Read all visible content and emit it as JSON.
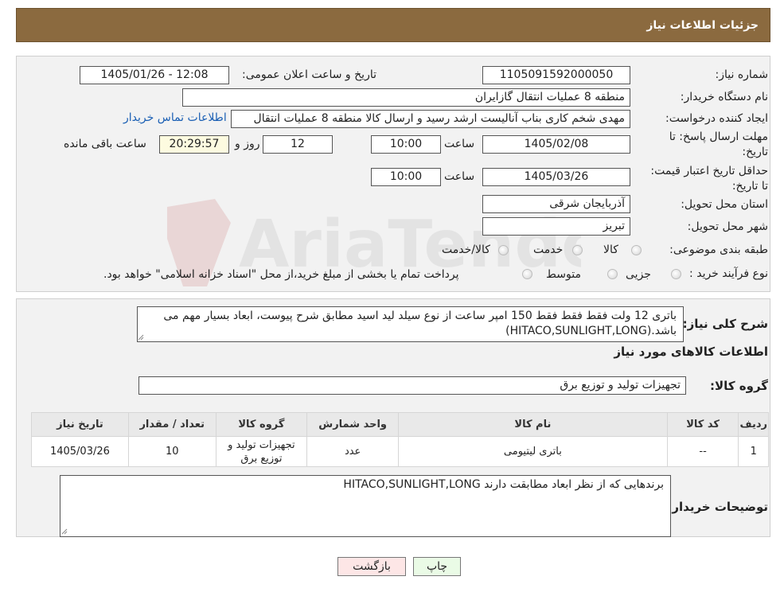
{
  "header": {
    "title": "جزئيات اطلاعات نیاز"
  },
  "watermark": {
    "text": "AriaTender.neT"
  },
  "form": {
    "need_number": {
      "label": "شماره نیاز:",
      "value": "1105091592000050"
    },
    "announce_datetime": {
      "label": "تاریخ و ساعت اعلان عمومی:",
      "value": "1405/01/26 - 12:08"
    },
    "buyer_org": {
      "label": "نام دستگاه خريدار:",
      "value": "منطقه 8 عملیات انتقال گازایران"
    },
    "requester": {
      "label": "ایجاد کننده درخواست:",
      "value": "مهدی شخم کاری بناب آنالیست ارشد رسید و ارسال کالا منطقه 8 عملیات انتقال",
      "contact_link": "اطلاعات تماس خریدار"
    },
    "reply_deadline": {
      "label": "مهلت ارسال پاسخ: تا تاریخ:",
      "date": "1405/02/08",
      "time_label": "ساعت",
      "time": "10:00",
      "days": "12",
      "days_label": "روز و",
      "remaining": "20:29:57",
      "remaining_label": "ساعت باقی مانده"
    },
    "price_validity": {
      "label": "حداقل تاریخ اعتبار قیمت: تا تاریخ:",
      "date": "1405/03/26",
      "time_label": "ساعت",
      "time": "10:00"
    },
    "province": {
      "label": "استان محل تحویل:",
      "value": "آذربایجان شرقی"
    },
    "city": {
      "label": "شهر محل تحویل:",
      "value": "تبریز"
    },
    "category": {
      "label": "طبقه بندی موضوعی:",
      "options": [
        "کالا",
        "خدمت",
        "کالا/خدمت"
      ]
    },
    "purchase_type": {
      "label": "نوع فرآیند خرید :",
      "options": [
        "جزیی",
        "متوسط"
      ],
      "note": "پرداخت تمام یا بخشی از مبلغ خرید،از محل \"اسناد خزانه اسلامی\" خواهد بود."
    }
  },
  "description": {
    "label": "شرح کلی نیاز:",
    "text": "باتری 12 ولت فقط فقط فقط 150 امپر ساعت از نوع سیلد لید اسید مطابق شرح پیوست، ابعاد بسیار مهم می باشد.(HITACO,SUNLIGHT,LONG)"
  },
  "goods": {
    "section_title": "اطلاعات کالاهای مورد نیاز",
    "group_label": "گروه کالا:",
    "group_value": "تجهیزات تولید و توزیع برق",
    "columns": [
      "ردیف",
      "کد کالا",
      "نام کالا",
      "واحد شمارش",
      "گروه کالا",
      "تعداد / مقدار",
      "تاریخ نیاز"
    ],
    "rows": [
      [
        "1",
        "--",
        "باتری لیتیومی",
        "عدد",
        "تجهیزات تولید و توزیع برق",
        "10",
        "1405/03/26"
      ]
    ]
  },
  "buyer_notes": {
    "label": "توضیحات خریدار:",
    "text": "برندهایی که از نظر ابعاد مطابقت دارند HITACO,SUNLIGHT,LONG"
  },
  "buttons": {
    "print": "چاپ",
    "back": "بازگشت"
  },
  "colors": {
    "header_bg": "#8b6a3f",
    "link": "#1a5fb4",
    "print_bg": "#eafbe6",
    "back_bg": "#fde6e6"
  }
}
